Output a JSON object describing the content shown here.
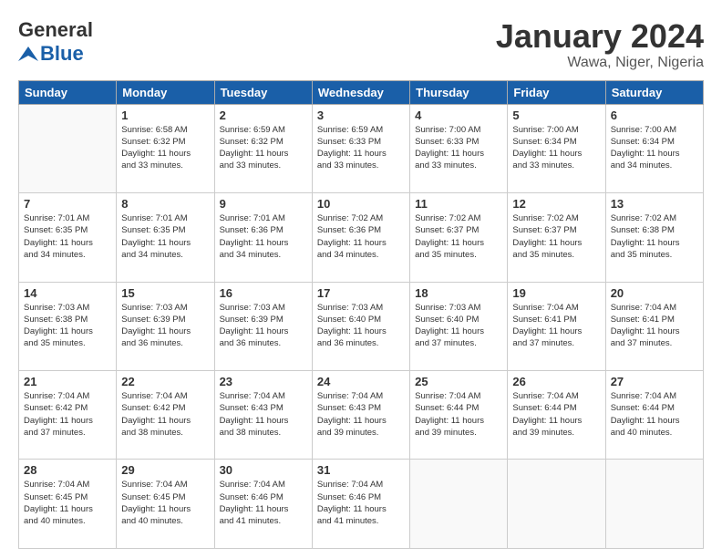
{
  "header": {
    "logo_general": "General",
    "logo_blue": "Blue",
    "title": "January 2024",
    "subtitle": "Wawa, Niger, Nigeria"
  },
  "weekdays": [
    "Sunday",
    "Monday",
    "Tuesday",
    "Wednesday",
    "Thursday",
    "Friday",
    "Saturday"
  ],
  "weeks": [
    [
      {
        "day": "",
        "info": ""
      },
      {
        "day": "1",
        "info": "Sunrise: 6:58 AM\nSunset: 6:32 PM\nDaylight: 11 hours\nand 33 minutes."
      },
      {
        "day": "2",
        "info": "Sunrise: 6:59 AM\nSunset: 6:32 PM\nDaylight: 11 hours\nand 33 minutes."
      },
      {
        "day": "3",
        "info": "Sunrise: 6:59 AM\nSunset: 6:33 PM\nDaylight: 11 hours\nand 33 minutes."
      },
      {
        "day": "4",
        "info": "Sunrise: 7:00 AM\nSunset: 6:33 PM\nDaylight: 11 hours\nand 33 minutes."
      },
      {
        "day": "5",
        "info": "Sunrise: 7:00 AM\nSunset: 6:34 PM\nDaylight: 11 hours\nand 33 minutes."
      },
      {
        "day": "6",
        "info": "Sunrise: 7:00 AM\nSunset: 6:34 PM\nDaylight: 11 hours\nand 34 minutes."
      }
    ],
    [
      {
        "day": "7",
        "info": "Sunrise: 7:01 AM\nSunset: 6:35 PM\nDaylight: 11 hours\nand 34 minutes."
      },
      {
        "day": "8",
        "info": "Sunrise: 7:01 AM\nSunset: 6:35 PM\nDaylight: 11 hours\nand 34 minutes."
      },
      {
        "day": "9",
        "info": "Sunrise: 7:01 AM\nSunset: 6:36 PM\nDaylight: 11 hours\nand 34 minutes."
      },
      {
        "day": "10",
        "info": "Sunrise: 7:02 AM\nSunset: 6:36 PM\nDaylight: 11 hours\nand 34 minutes."
      },
      {
        "day": "11",
        "info": "Sunrise: 7:02 AM\nSunset: 6:37 PM\nDaylight: 11 hours\nand 35 minutes."
      },
      {
        "day": "12",
        "info": "Sunrise: 7:02 AM\nSunset: 6:37 PM\nDaylight: 11 hours\nand 35 minutes."
      },
      {
        "day": "13",
        "info": "Sunrise: 7:02 AM\nSunset: 6:38 PM\nDaylight: 11 hours\nand 35 minutes."
      }
    ],
    [
      {
        "day": "14",
        "info": "Sunrise: 7:03 AM\nSunset: 6:38 PM\nDaylight: 11 hours\nand 35 minutes."
      },
      {
        "day": "15",
        "info": "Sunrise: 7:03 AM\nSunset: 6:39 PM\nDaylight: 11 hours\nand 36 minutes."
      },
      {
        "day": "16",
        "info": "Sunrise: 7:03 AM\nSunset: 6:39 PM\nDaylight: 11 hours\nand 36 minutes."
      },
      {
        "day": "17",
        "info": "Sunrise: 7:03 AM\nSunset: 6:40 PM\nDaylight: 11 hours\nand 36 minutes."
      },
      {
        "day": "18",
        "info": "Sunrise: 7:03 AM\nSunset: 6:40 PM\nDaylight: 11 hours\nand 37 minutes."
      },
      {
        "day": "19",
        "info": "Sunrise: 7:04 AM\nSunset: 6:41 PM\nDaylight: 11 hours\nand 37 minutes."
      },
      {
        "day": "20",
        "info": "Sunrise: 7:04 AM\nSunset: 6:41 PM\nDaylight: 11 hours\nand 37 minutes."
      }
    ],
    [
      {
        "day": "21",
        "info": "Sunrise: 7:04 AM\nSunset: 6:42 PM\nDaylight: 11 hours\nand 37 minutes."
      },
      {
        "day": "22",
        "info": "Sunrise: 7:04 AM\nSunset: 6:42 PM\nDaylight: 11 hours\nand 38 minutes."
      },
      {
        "day": "23",
        "info": "Sunrise: 7:04 AM\nSunset: 6:43 PM\nDaylight: 11 hours\nand 38 minutes."
      },
      {
        "day": "24",
        "info": "Sunrise: 7:04 AM\nSunset: 6:43 PM\nDaylight: 11 hours\nand 39 minutes."
      },
      {
        "day": "25",
        "info": "Sunrise: 7:04 AM\nSunset: 6:44 PM\nDaylight: 11 hours\nand 39 minutes."
      },
      {
        "day": "26",
        "info": "Sunrise: 7:04 AM\nSunset: 6:44 PM\nDaylight: 11 hours\nand 39 minutes."
      },
      {
        "day": "27",
        "info": "Sunrise: 7:04 AM\nSunset: 6:44 PM\nDaylight: 11 hours\nand 40 minutes."
      }
    ],
    [
      {
        "day": "28",
        "info": "Sunrise: 7:04 AM\nSunset: 6:45 PM\nDaylight: 11 hours\nand 40 minutes."
      },
      {
        "day": "29",
        "info": "Sunrise: 7:04 AM\nSunset: 6:45 PM\nDaylight: 11 hours\nand 40 minutes."
      },
      {
        "day": "30",
        "info": "Sunrise: 7:04 AM\nSunset: 6:46 PM\nDaylight: 11 hours\nand 41 minutes."
      },
      {
        "day": "31",
        "info": "Sunrise: 7:04 AM\nSunset: 6:46 PM\nDaylight: 11 hours\nand 41 minutes."
      },
      {
        "day": "",
        "info": ""
      },
      {
        "day": "",
        "info": ""
      },
      {
        "day": "",
        "info": ""
      }
    ]
  ]
}
